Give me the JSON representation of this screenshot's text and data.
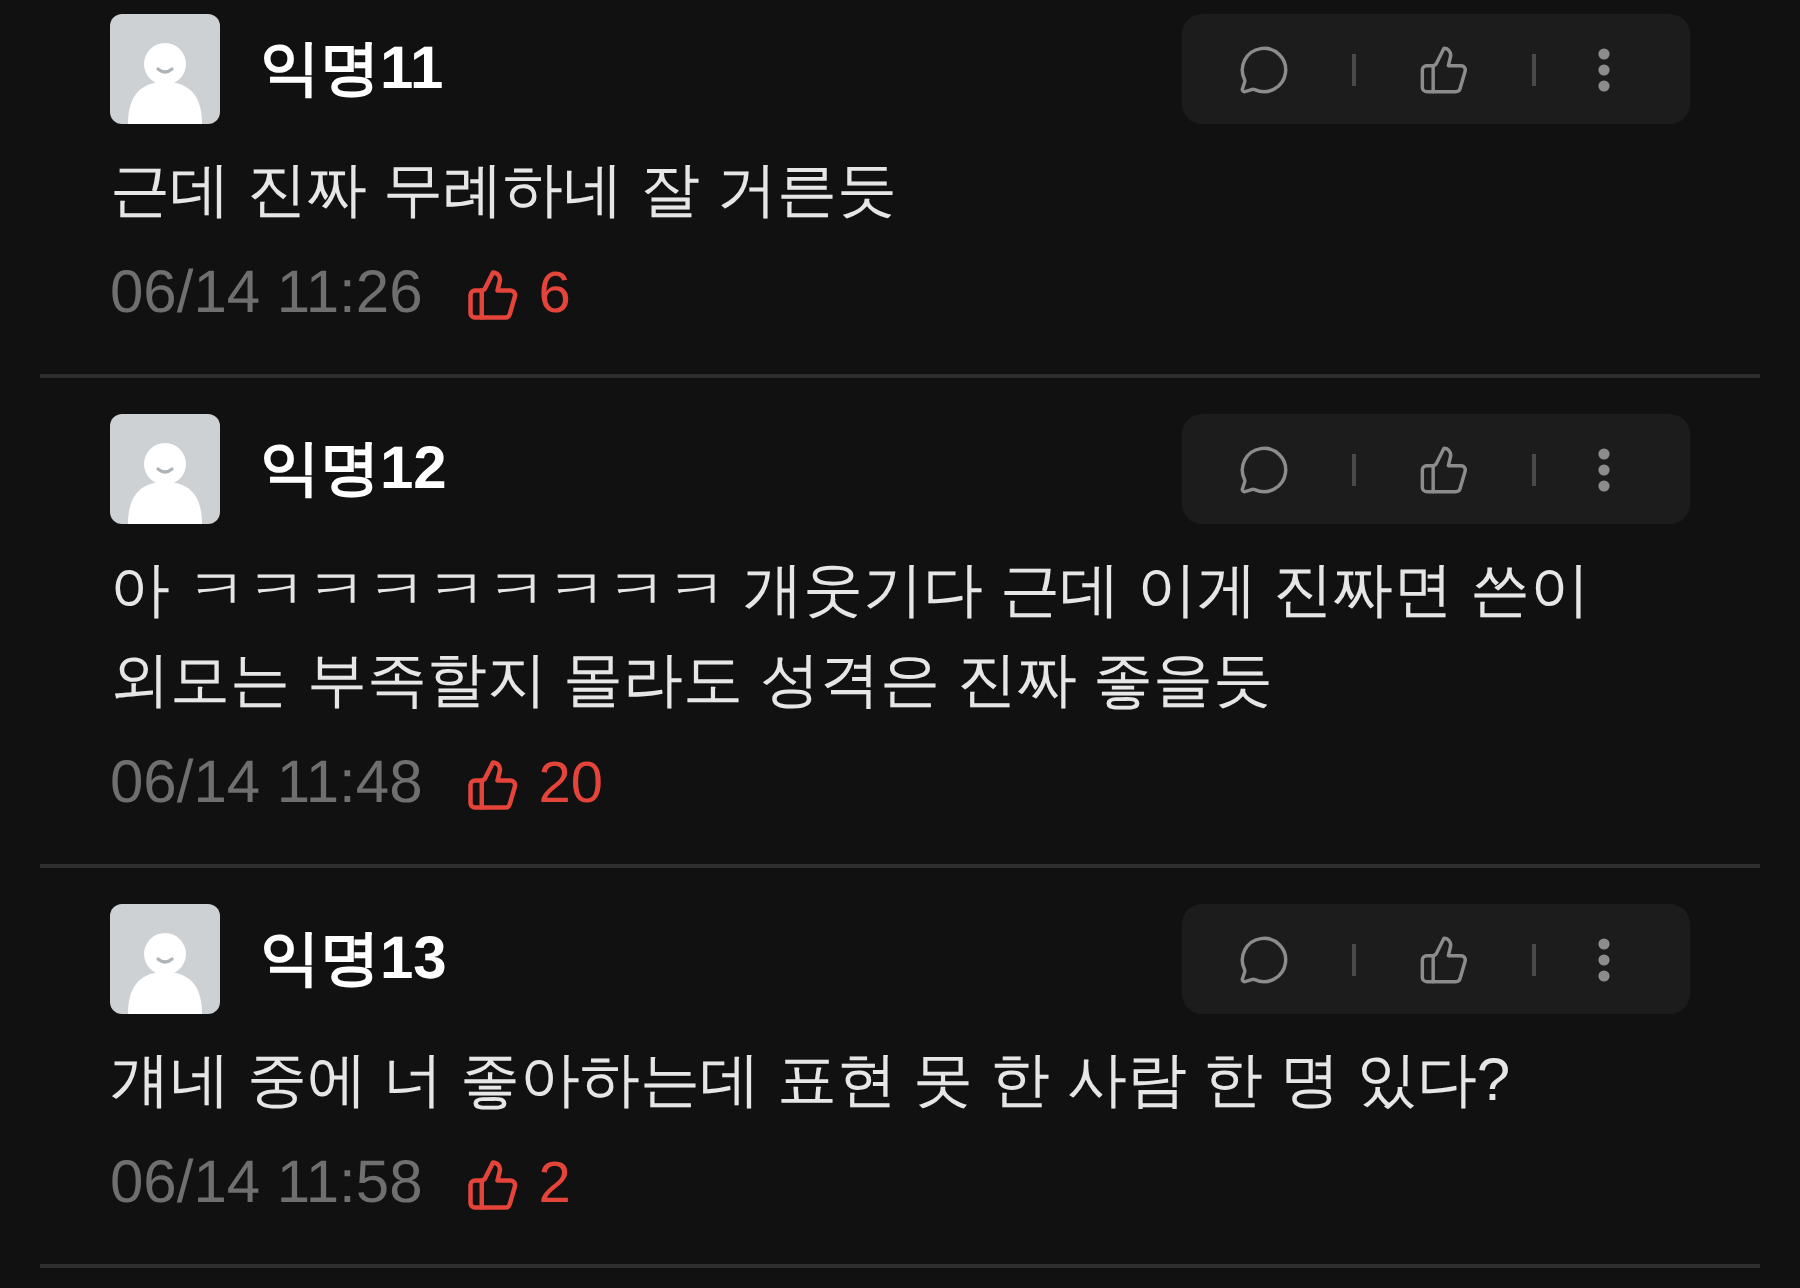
{
  "comments": [
    {
      "author": "익명11",
      "text": "근데 진짜 무례하네 잘 거른듯",
      "time": "06/14 11:26",
      "likes": "6"
    },
    {
      "author": "익명12",
      "text": "아 ㅋㅋㅋㅋㅋㅋㅋㅋㅋ 개웃기다 근데 이게 진짜면 쓴이 외모는 부족할지 몰라도 성격은 진짜 좋을듯",
      "time": "06/14 11:48",
      "likes": "20"
    },
    {
      "author": "익명13",
      "text": "걔네 중에 너 좋아하는데 표현 못 한 사람 한 명 있다?",
      "time": "06/14 11:58",
      "likes": "2"
    }
  ]
}
